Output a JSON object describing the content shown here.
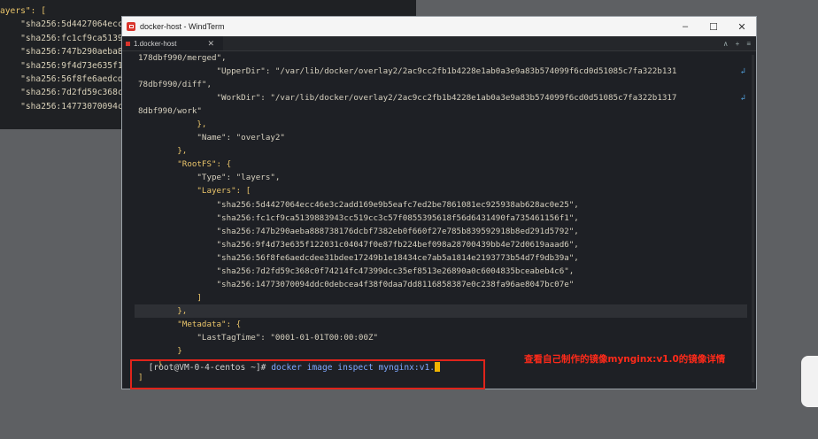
{
  "background_terminal": {
    "lines": [
      {
        "key": "Layers",
        "text": "ayers\": ["
      },
      {
        "text": "    \"sha256:5d4427064ecc"
      },
      {
        "text": "    \"sha256:fc1cf9ca5139"
      },
      {
        "text": "    \"sha256:747b290aeba8"
      },
      {
        "text": "    \"sha256:9f4d73e635f1"
      },
      {
        "text": "    \"sha256:56f8fe6aedcd"
      },
      {
        "text": "    \"sha256:7d2fd59c368c"
      },
      {
        "text": "    \"sha256:14773070094c"
      }
    ]
  },
  "window": {
    "title": "docker-host - WindTerm",
    "controls": {
      "minimize": "–",
      "maximize": "☐",
      "close": "✕"
    },
    "tab": {
      "label": "1.docker-host",
      "close": "✕"
    },
    "tab_tools": [
      "∧",
      "+",
      "≡"
    ]
  },
  "terminal": {
    "lines": [
      "178dbf990/merged\",",
      "                \"UpperDir\": \"/var/lib/docker/overlay2/2ac9cc2fb1b4228e1ab0a3e9a83b574099f6cd0d51085c7fa322b131",
      "78dbf990/diff\",",
      "                \"WorkDir\": \"/var/lib/docker/overlay2/2ac9cc2fb1b4228e1ab0a3e9a83b574099f6cd0d51085c7fa322b1317",
      "8dbf990/work\"",
      "            },",
      "            \"Name\": \"overlay2\"",
      "        },",
      "        \"RootFS\": {",
      "            \"Type\": \"layers\",",
      "            \"Layers\": [",
      "                \"sha256:5d4427064ecc46e3c2add169e9b5eafc7ed2be7861081ec925938ab628ac0e25\",",
      "                \"sha256:fc1cf9ca5139883943cc519cc3c57f0855395618f56d6431490fa735461156f1\",",
      "                \"sha256:747b290aeba888738176dcbf7382eb0f660f27e785b839592918b8ed291d5792\",",
      "                \"sha256:9f4d73e635f122031c04047f0e87fb224bef098a28700439bb4e72d0619aaad6\",",
      "                \"sha256:56f8fe6aedcdee31bdee17249b1e18434ce7ab5a1814e2193773b54d7f9db39a\",",
      "                \"sha256:7d2fd59c368c0f74214fc47399dcc35ef8513e26890a0c6004835bceabeb4c6\",",
      "                \"sha256:14773070094ddc0debcea4f38f0daa7dd8116858387e0c238fa96ae8047bc07e\"",
      "            ]",
      "        },",
      "        \"Metadata\": {",
      "            \"LastTagTime\": \"0001-01-01T00:00:00Z\"",
      "        }",
      "    }",
      "]"
    ],
    "wrap_marker": "↲",
    "prompt": "[root@VM-0-4-centos ~]#",
    "command": "docker image inspect mynginx:v1."
  },
  "annotation": "查看自己制作的镜像mynginx:v1.0的镜像详情",
  "colors": {
    "annotation": "#ff2a1a",
    "highlight_box": "#e0241b",
    "json_key": "#e9c46a",
    "command": "#7fa8ff",
    "cursor": "#f0b400"
  }
}
